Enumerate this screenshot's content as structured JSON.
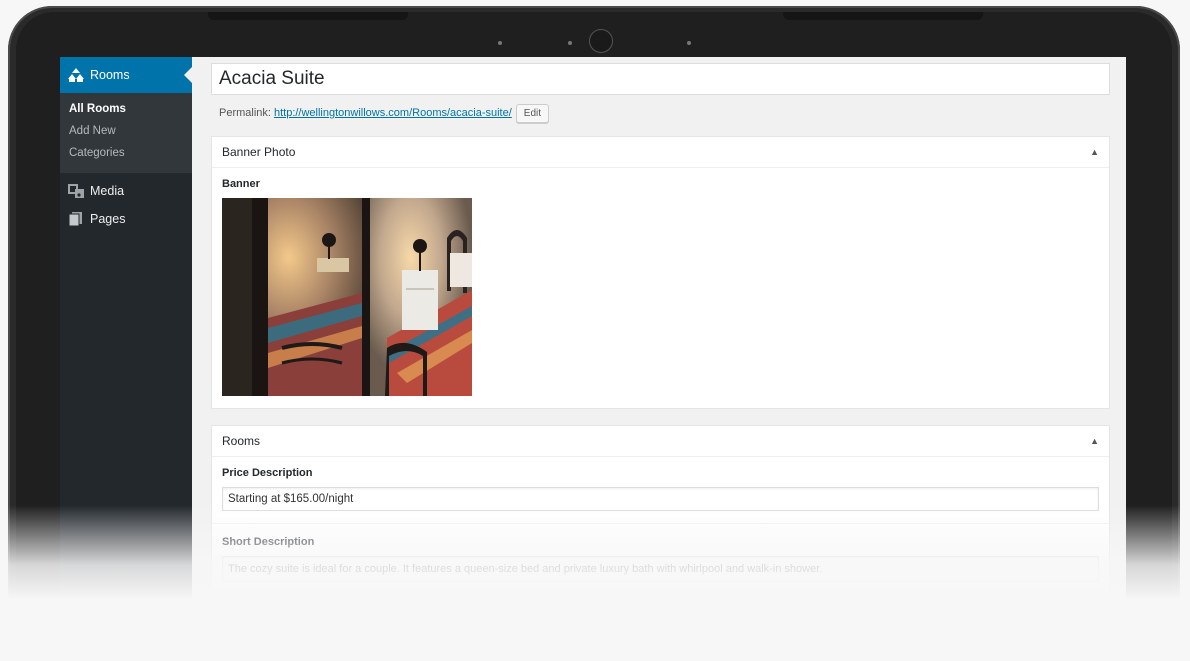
{
  "sidebar": {
    "active_menu": {
      "label": "Rooms",
      "icon": "rooms-icon"
    },
    "submenu": [
      {
        "label": "All Rooms",
        "current": true
      },
      {
        "label": "Add New",
        "current": false
      },
      {
        "label": "Categories",
        "current": false
      }
    ],
    "menu": [
      {
        "label": "Media",
        "icon": "media-icon"
      },
      {
        "label": "Pages",
        "icon": "pages-icon"
      }
    ]
  },
  "editor": {
    "title": "Acacia Suite",
    "permalink": {
      "label": "Permalink:",
      "url": "http://wellingtonwillows.com/Rooms/acacia-suite/",
      "edit_label": "Edit"
    }
  },
  "banner_box": {
    "title": "Banner Photo",
    "field_label": "Banner",
    "image_description": "bedroom-photo"
  },
  "rooms_box": {
    "title": "Rooms",
    "price_label": "Price Description",
    "price_value": "Starting at $165.00/night",
    "short_desc_label": "Short Description",
    "short_desc_value": "The cozy suite is ideal for a couple. It features a queen-size bed and private luxury bath with whirlpool and walk-in shower."
  },
  "colors": {
    "accent": "#0073aa",
    "sidebar": "#23282d",
    "submenu": "#32373c"
  }
}
